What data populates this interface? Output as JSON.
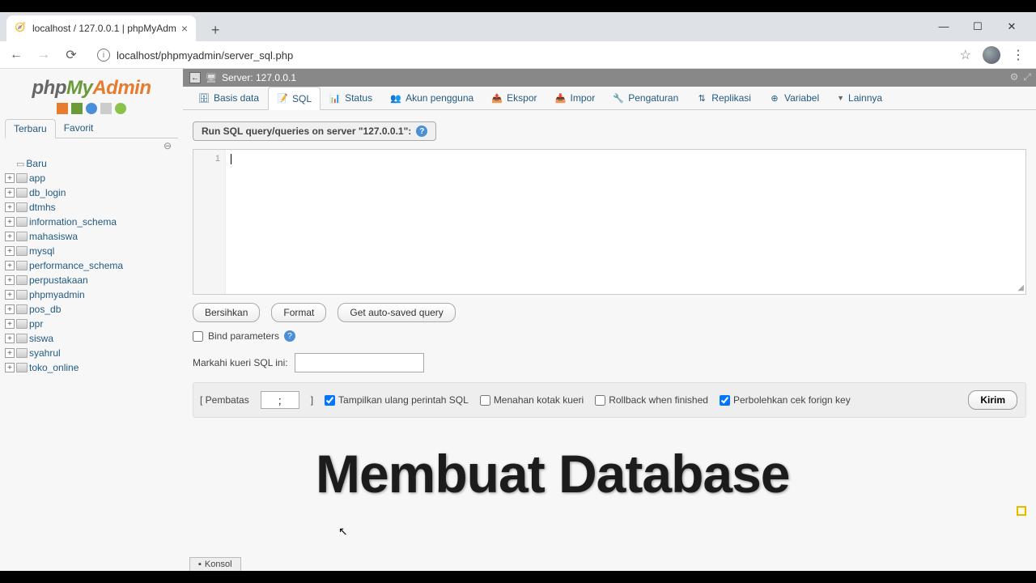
{
  "browser": {
    "tab_title": "localhost / 127.0.0.1 | phpMyAdm",
    "url": "localhost/phpmyadmin/server_sql.php"
  },
  "logo": {
    "p1": "php",
    "p2": "My",
    "p3": "Admin"
  },
  "sidebar": {
    "tabs": {
      "recent": "Terbaru",
      "favorite": "Favorit"
    },
    "new_label": "Baru",
    "databases": [
      "app",
      "db_login",
      "dtmhs",
      "information_schema",
      "mahasiswa",
      "mysql",
      "performance_schema",
      "perpustakaan",
      "phpmyadmin",
      "pos_db",
      "ppr",
      "siswa",
      "syahrul",
      "toko_online"
    ]
  },
  "server_bar": {
    "label": "Server: 127.0.0.1"
  },
  "main_tabs": {
    "databases": "Basis data",
    "sql": "SQL",
    "status": "Status",
    "users": "Akun pengguna",
    "export": "Ekspor",
    "import": "Impor",
    "settings": "Pengaturan",
    "replication": "Replikasi",
    "variables": "Variabel",
    "more": "Lainnya"
  },
  "sql_panel": {
    "header": "Run SQL query/queries on server \"127.0.0.1\":",
    "line_number": "1",
    "clear": "Bersihkan",
    "format": "Format",
    "autosaved": "Get auto-saved query",
    "bind_params": "Bind parameters",
    "bookmark_label": "Markahi kueri SQL ini:",
    "delimiter_label_open": "[ Pembatas",
    "delimiter_value": ";",
    "delimiter_label_close": "]",
    "opt_show_again": "Tampilkan ulang perintah SQL",
    "opt_retain": "Menahan kotak kueri",
    "opt_rollback": "Rollback when finished",
    "opt_fk": "Perbolehkan cek forign key",
    "submit": "Kirim"
  },
  "console": {
    "label": "Konsol"
  },
  "overlay": {
    "text": "Membuat Database"
  }
}
